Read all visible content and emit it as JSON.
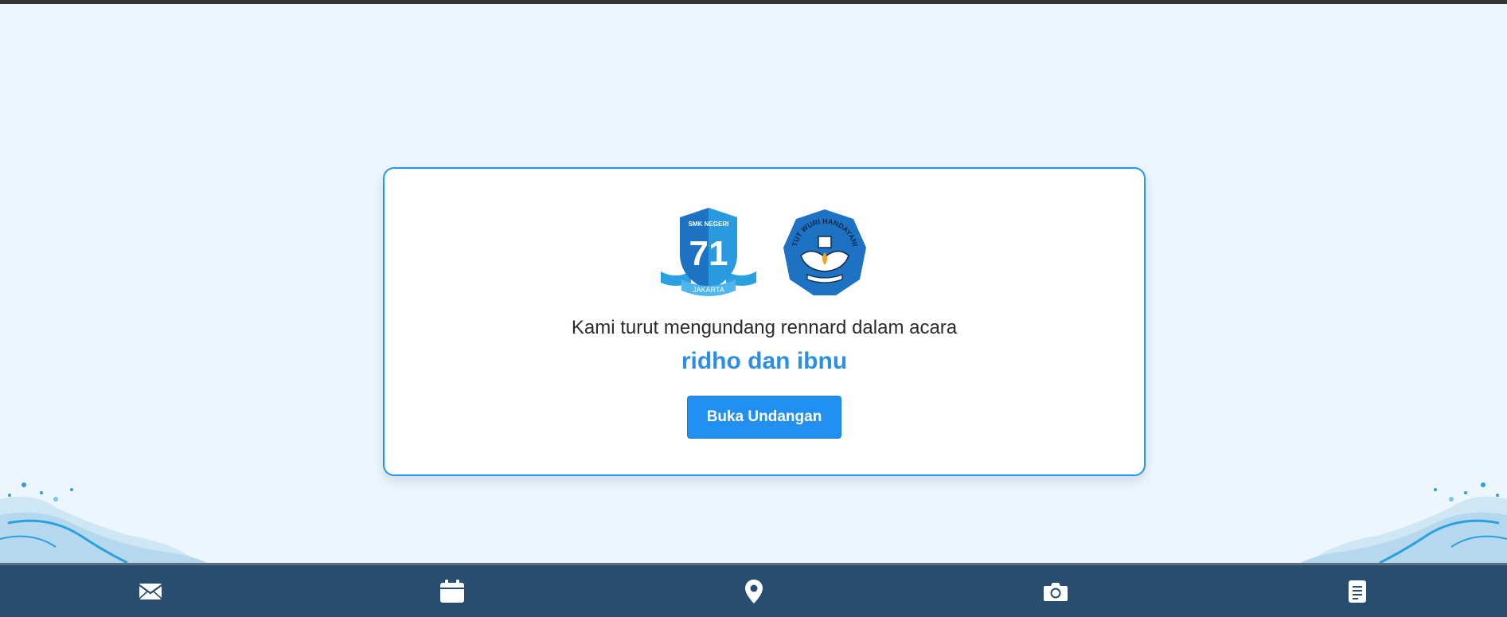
{
  "card": {
    "logos": [
      {
        "icon": "smk-negeri-71-jakarta-logo-icon",
        "text_lines": [
          "SMK NEGERI",
          "71",
          "JAKARTA"
        ]
      },
      {
        "icon": "tut-wuri-handayani-logo-icon",
        "text_lines": [
          "TUT WURI HANDAYANI"
        ]
      }
    ],
    "invite_text": "Kami turut mengundang rennard dalam acara",
    "event_name": "ridho dan ibnu",
    "open_button_label": "Buka Undangan"
  },
  "bottom_nav": {
    "items": [
      {
        "icon": "envelope-icon"
      },
      {
        "icon": "calendar-icon"
      },
      {
        "icon": "location-pin-icon"
      },
      {
        "icon": "camera-icon"
      },
      {
        "icon": "document-icon"
      }
    ]
  },
  "colors": {
    "background": "#eef6fd",
    "accent": "#2190f0",
    "event_name": "#2b8fe3",
    "nav_bar": "#284d6f",
    "card_border": "#2196f3"
  }
}
